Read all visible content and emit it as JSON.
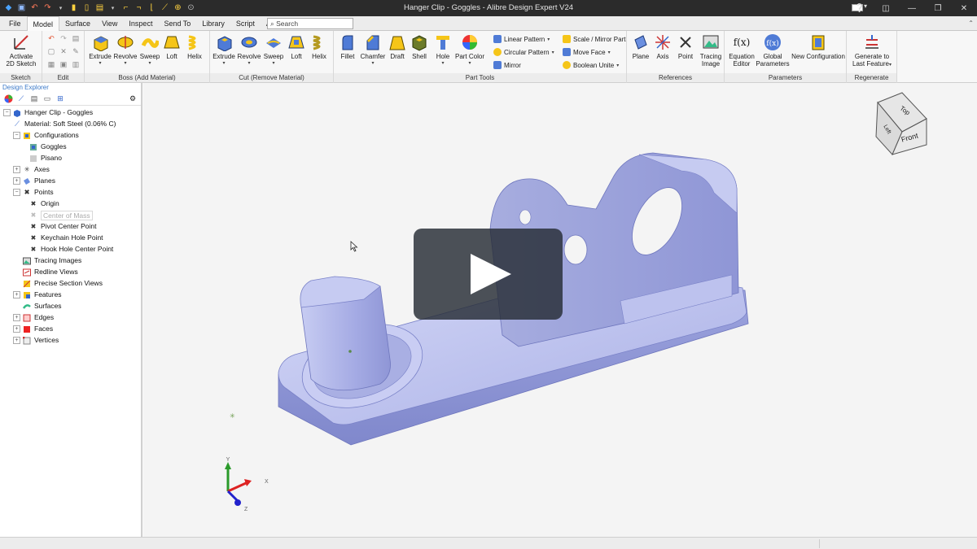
{
  "window": {
    "title": "Hanger Clip - Goggles - Alibre Design Expert V24"
  },
  "menu": {
    "tabs": [
      "File",
      "Model",
      "Surface",
      "View",
      "Inspect",
      "Send To",
      "Library",
      "Script",
      "Add-on"
    ],
    "active_tab": "Model",
    "search_placeholder": "Search"
  },
  "ribbon": {
    "sketch": {
      "label": "Sketch",
      "activate": "Activate",
      "activate2": "2D Sketch"
    },
    "edit": {
      "label": "Edit"
    },
    "boss": {
      "label": "Boss (Add Material)",
      "buttons": [
        "Extrude",
        "Revolve",
        "Sweep",
        "Loft",
        "Helix"
      ]
    },
    "cut": {
      "label": "Cut (Remove Material)",
      "buttons": [
        "Extrude",
        "Revolve",
        "Sweep",
        "Loft",
        "Helix"
      ]
    },
    "part_tools": {
      "label": "Part Tools",
      "buttons": [
        "Fillet",
        "Chamfer",
        "Draft",
        "Shell",
        "Hole",
        "Part Color"
      ],
      "small": [
        "Linear Pattern",
        "Circular Pattern",
        "Mirror",
        "Scale / Mirror Part",
        "Move Face",
        "Boolean Unite"
      ]
    },
    "references": {
      "label": "References",
      "buttons": [
        "Plane",
        "Axis",
        "Point",
        "Tracing",
        "Image"
      ]
    },
    "parameters": {
      "label": "Parameters",
      "buttons": [
        "Equation",
        "Editor",
        "Global",
        "Parameters",
        "New Configuration"
      ]
    },
    "regenerate": {
      "label": "Regenerate",
      "line1": "Generate to",
      "line2": "Last Feature"
    }
  },
  "explorer": {
    "title": "Design Explorer",
    "tree": [
      {
        "label": "Hanger Clip - Goggles",
        "icon": "part-icon"
      },
      {
        "label": "Material: Soft Steel (0.06% C)",
        "icon": "material-icon"
      },
      {
        "label": "Configurations",
        "icon": "configurations-icon"
      },
      {
        "label": "Goggles",
        "icon": "config-icon"
      },
      {
        "label": "Pisano",
        "icon": "config-icon"
      },
      {
        "label": "Axes",
        "icon": "axes-icon"
      },
      {
        "label": "Planes",
        "icon": "planes-icon"
      },
      {
        "label": "Points",
        "icon": "points-icon"
      },
      {
        "label": "Origin",
        "icon": "point-icon"
      },
      {
        "label": "Center of Mass",
        "icon": "point-icon"
      },
      {
        "label": "Pivot Center Point",
        "icon": "point-icon"
      },
      {
        "label": "Keychain Hole Point",
        "icon": "point-icon"
      },
      {
        "label": "Hook Hole Center Point",
        "icon": "point-icon"
      },
      {
        "label": "Tracing Images",
        "icon": "tracing-icon"
      },
      {
        "label": "Redline Views",
        "icon": "redline-icon"
      },
      {
        "label": "Precise Section Views",
        "icon": "section-icon"
      },
      {
        "label": "Features",
        "icon": "features-icon"
      },
      {
        "label": "Surfaces",
        "icon": "surfaces-icon"
      },
      {
        "label": "Edges",
        "icon": "edges-icon"
      },
      {
        "label": "Faces",
        "icon": "faces-icon"
      },
      {
        "label": "Vertices",
        "icon": "vertices-icon"
      }
    ]
  },
  "viewcube": {
    "top": "Top",
    "front": "Front",
    "left": "Left"
  },
  "triad": {
    "x": "X",
    "y": "Y",
    "z": "Z"
  },
  "colors": {
    "part": "#aab0e6",
    "titlebar": "#2b2b2b",
    "accent": "#3b79c8"
  }
}
